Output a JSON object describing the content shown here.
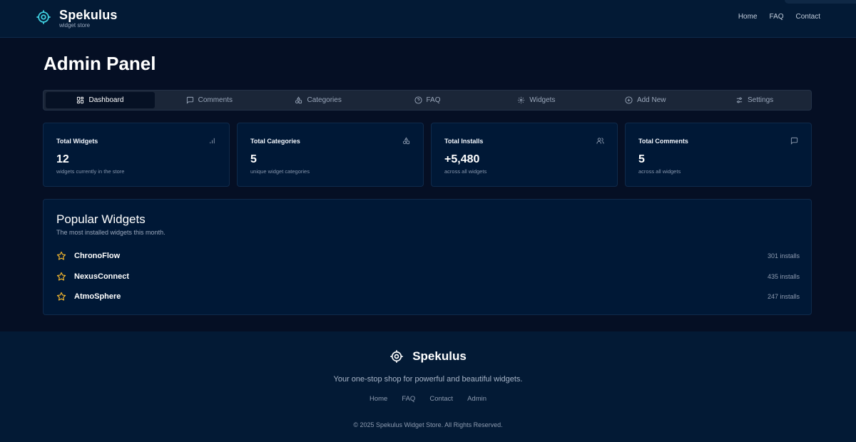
{
  "header": {
    "brand_name": "Spekulus",
    "brand_sub": "widget store",
    "nav": [
      "Home",
      "FAQ",
      "Contact"
    ]
  },
  "page_title": "Admin Panel",
  "tabs": [
    {
      "label": "Dashboard",
      "icon": "dashboard-icon",
      "active": true
    },
    {
      "label": "Comments",
      "icon": "comment-icon"
    },
    {
      "label": "Categories",
      "icon": "shapes-icon"
    },
    {
      "label": "FAQ",
      "icon": "help-circle-icon"
    },
    {
      "label": "Widgets",
      "icon": "gear-icon"
    },
    {
      "label": "Add New",
      "icon": "plus-circle-icon"
    },
    {
      "label": "Settings",
      "icon": "sliders-icon"
    }
  ],
  "stats": [
    {
      "title": "Total Widgets",
      "value": "12",
      "sub": "widgets currently in the store",
      "icon": "bar-chart-icon"
    },
    {
      "title": "Total Categories",
      "value": "5",
      "sub": "unique widget categories",
      "icon": "shapes-icon"
    },
    {
      "title": "Total Installs",
      "value": "+5,480",
      "sub": "across all widgets",
      "icon": "users-icon"
    },
    {
      "title": "Total Comments",
      "value": "5",
      "sub": "across all widgets",
      "icon": "comment-icon"
    }
  ],
  "popular": {
    "title": "Popular Widgets",
    "subtitle": "The most installed widgets this month.",
    "items": [
      {
        "name": "ChronoFlow",
        "installs": "301 installs"
      },
      {
        "name": "NexusConnect",
        "installs": "435 installs"
      },
      {
        "name": "AtmoSphere",
        "installs": "247 installs"
      }
    ]
  },
  "footer": {
    "brand_name": "Spekulus",
    "tagline": "Your one-stop shop for powerful and beautiful widgets.",
    "nav": [
      "Home",
      "FAQ",
      "Contact",
      "Admin"
    ],
    "copyright": "© 2025 Spekulus Widget Store. All Rights Reserved."
  },
  "colors": {
    "accent": "#3fd0e0",
    "star": "#f5b82e",
    "background": "#050f24",
    "card": "#001836"
  }
}
